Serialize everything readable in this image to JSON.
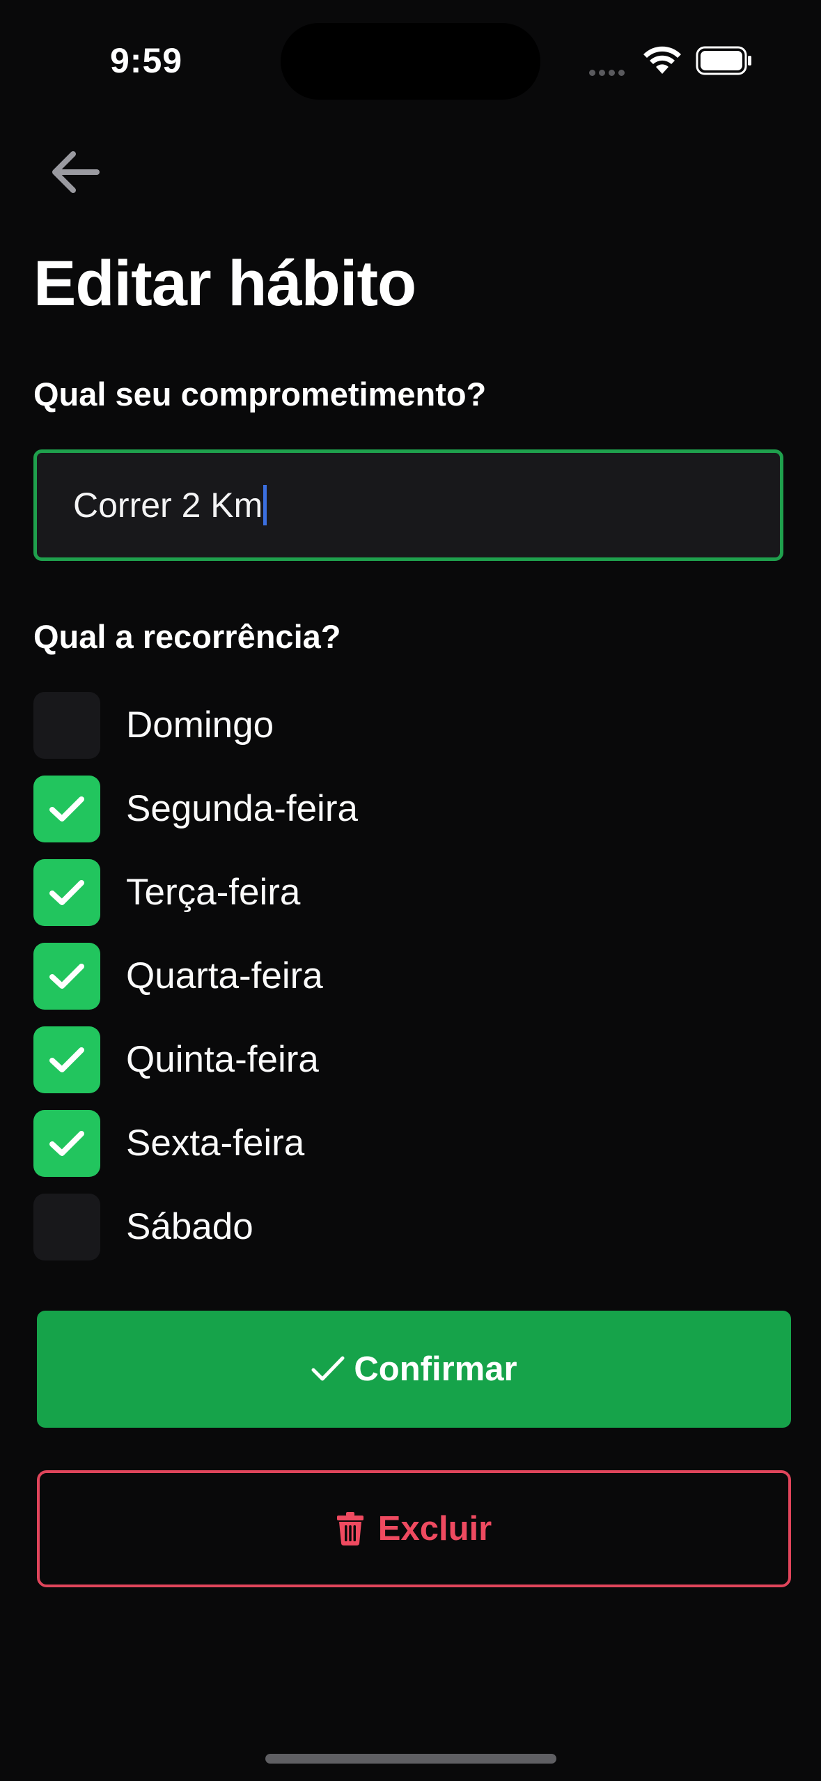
{
  "status_bar": {
    "time": "9:59"
  },
  "header": {
    "title": "Editar hábito"
  },
  "form": {
    "commitment_label": "Qual seu comprometimento?",
    "commitment_value": "Correr 2 Km",
    "recurrence_label": "Qual a recorrência?"
  },
  "days": [
    {
      "label": "Domingo",
      "checked": false
    },
    {
      "label": "Segunda-feira",
      "checked": true
    },
    {
      "label": "Terça-feira",
      "checked": true
    },
    {
      "label": "Quarta-feira",
      "checked": true
    },
    {
      "label": "Quinta-feira",
      "checked": true
    },
    {
      "label": "Sexta-feira",
      "checked": true
    },
    {
      "label": "Sábado",
      "checked": false
    }
  ],
  "actions": {
    "confirm_label": "Confirmar",
    "delete_label": "Excluir"
  },
  "icons": {
    "back": "arrow-left-icon",
    "check": "check-icon",
    "trash": "trash-icon"
  },
  "colors": {
    "background": "#09090a",
    "accent_green": "#16a34a",
    "checkbox_green": "#22c55e",
    "danger": "#ef4a60"
  }
}
